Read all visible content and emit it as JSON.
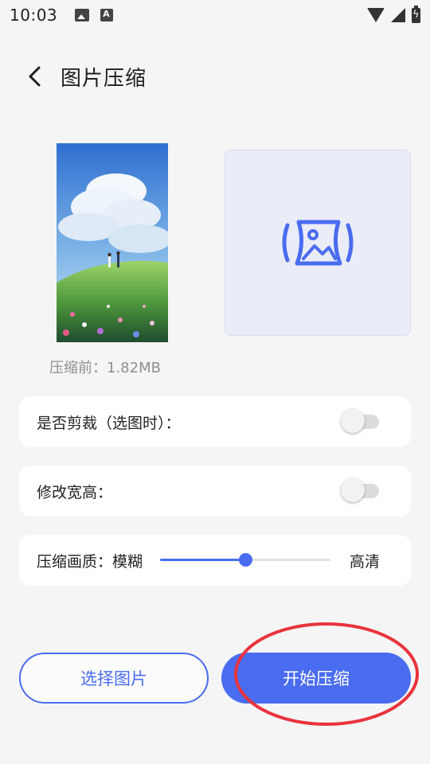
{
  "status_bar": {
    "time": "10:03",
    "icons": [
      "image-notification-icon",
      "a-notification-icon",
      "wifi-icon",
      "signal-icon",
      "battery-charging-icon"
    ]
  },
  "header": {
    "title": "图片压缩",
    "back_icon": "chevron-left-icon"
  },
  "preview": {
    "before_label": "压缩前：1.82MB",
    "placeholder_icon": "image-compress-icon"
  },
  "options": {
    "crop_label": "是否剪裁（选图时）：",
    "crop_enabled": false,
    "resize_label": "修改宽高：",
    "resize_enabled": false,
    "quality_label": "压缩画质：模糊",
    "quality_high_label": "高清",
    "quality_value": 0.5
  },
  "buttons": {
    "select_label": "选择图片",
    "start_label": "开始压缩"
  },
  "colors": {
    "accent": "#4a6cf0",
    "background": "#f5f5f5",
    "card": "#ffffff",
    "annotation": "#e8333d"
  }
}
